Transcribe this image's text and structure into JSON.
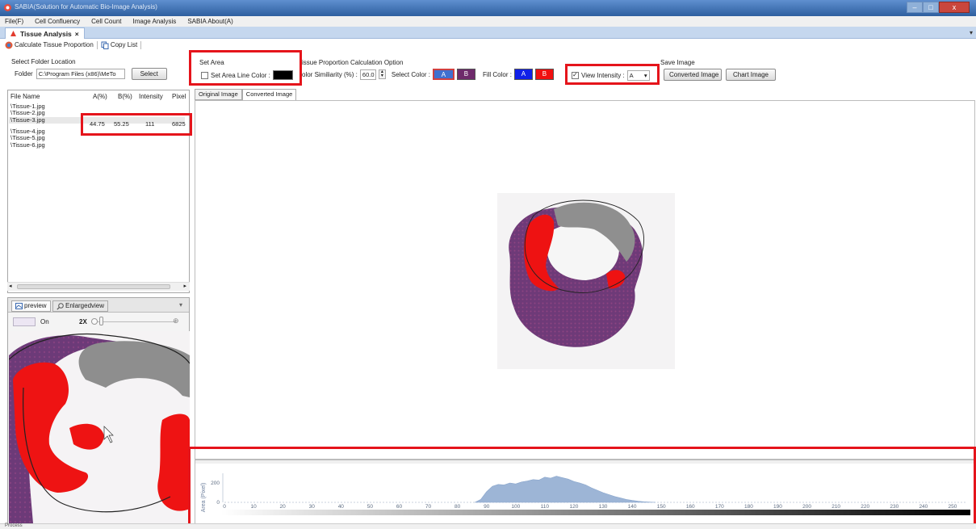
{
  "window": {
    "title": "SABIA(Solution for Automatic Bio-Image Analysis)",
    "buttons": [
      "–",
      "□",
      "x"
    ]
  },
  "menu": [
    "File(F)",
    "Cell Confluency",
    "Cell Count",
    "Image Analysis",
    "SABIA About(A)"
  ],
  "doc_tab": {
    "label": "Tissue Analysis",
    "close": "×"
  },
  "toolbar": {
    "calculate": "Calculate Tissue Proportion",
    "copy": "Copy List"
  },
  "folder": {
    "section_title": "Select Folder Location",
    "label": "Folder",
    "path": "C:\\Program Files (x86)\\MeTo",
    "select_button": "Select"
  },
  "file_list": {
    "headers": [
      "File Name",
      "A(%)",
      "B(%)",
      "Intensity",
      "Pixel"
    ],
    "files": [
      "\\Tissue-1.jpg",
      "\\Tissue-2.jpg",
      "\\Tissue-3.jpg",
      "\\Tissue-4.jpg",
      "\\Tissue-5.jpg",
      "\\Tissue-6.jpg"
    ],
    "selected_values": {
      "a": "44.75",
      "b": "55.25",
      "intensity": "111",
      "pixel": "6825"
    }
  },
  "preview": {
    "tab_preview": "preview",
    "tab_enlarged": "Enlargedview",
    "toggle_label": "On",
    "zoom_label": "2X",
    "zoom_plus": "⊕",
    "dropdown_arrow": "▾"
  },
  "set_area": {
    "title": "Set Area",
    "checkbox_label": "Set Area Line Color :",
    "line_color": "#000000"
  },
  "calc_options": {
    "title": "Tissue Proportion Calculation Option",
    "title_visible": "issue Proportion Calculation Option",
    "similarity_label_visible": "olor Similiarity (%) :",
    "similarity_value": "60.0",
    "select_color_label": "Select Color :",
    "select_a": "A",
    "select_b": "B",
    "select_a_color": "#3f6fcf",
    "select_b_color": "#6e2a6b",
    "fill_color_label": "Fill Color :",
    "fill_a": "A",
    "fill_b": "B",
    "fill_a_color": "#1020e8",
    "fill_b_color": "#f01010",
    "view_intensity_label": "View Intensity :",
    "view_intensity_value": "A",
    "view_intensity_checked": true
  },
  "save_image": {
    "title_visible": "Save Image",
    "converted_button": "Converted Image",
    "chart_button": "Chart Image"
  },
  "view_tabs": [
    "Original Image",
    "Converted Image"
  ],
  "chart_data": {
    "type": "area",
    "title": "",
    "xlabel": "",
    "ylabel": "Area (Pixel)",
    "xlim": [
      0,
      255
    ],
    "ylim": [
      0,
      300
    ],
    "x_ticks": [
      0,
      10,
      20,
      30,
      40,
      50,
      60,
      70,
      80,
      90,
      100,
      110,
      120,
      130,
      140,
      150,
      160,
      170,
      180,
      190,
      200,
      210,
      220,
      230,
      240,
      250
    ],
    "y_ticks": [
      0,
      200
    ],
    "series": [
      {
        "color": "#9db5d6",
        "x": [
          86,
          88,
          90,
          92,
          94,
          96,
          98,
          100,
          102,
          104,
          106,
          108,
          110,
          112,
          114,
          116,
          118,
          120,
          122,
          124,
          126,
          128,
          130,
          132,
          134,
          136,
          138,
          140,
          142,
          144,
          146,
          148
        ],
        "y": [
          0,
          30,
          110,
          165,
          185,
          180,
          200,
          190,
          210,
          220,
          235,
          230,
          260,
          250,
          270,
          255,
          240,
          215,
          200,
          180,
          150,
          125,
          100,
          80,
          60,
          45,
          30,
          20,
          12,
          6,
          3,
          0
        ]
      }
    ],
    "grid": false,
    "legend": "none"
  },
  "status": "Process"
}
